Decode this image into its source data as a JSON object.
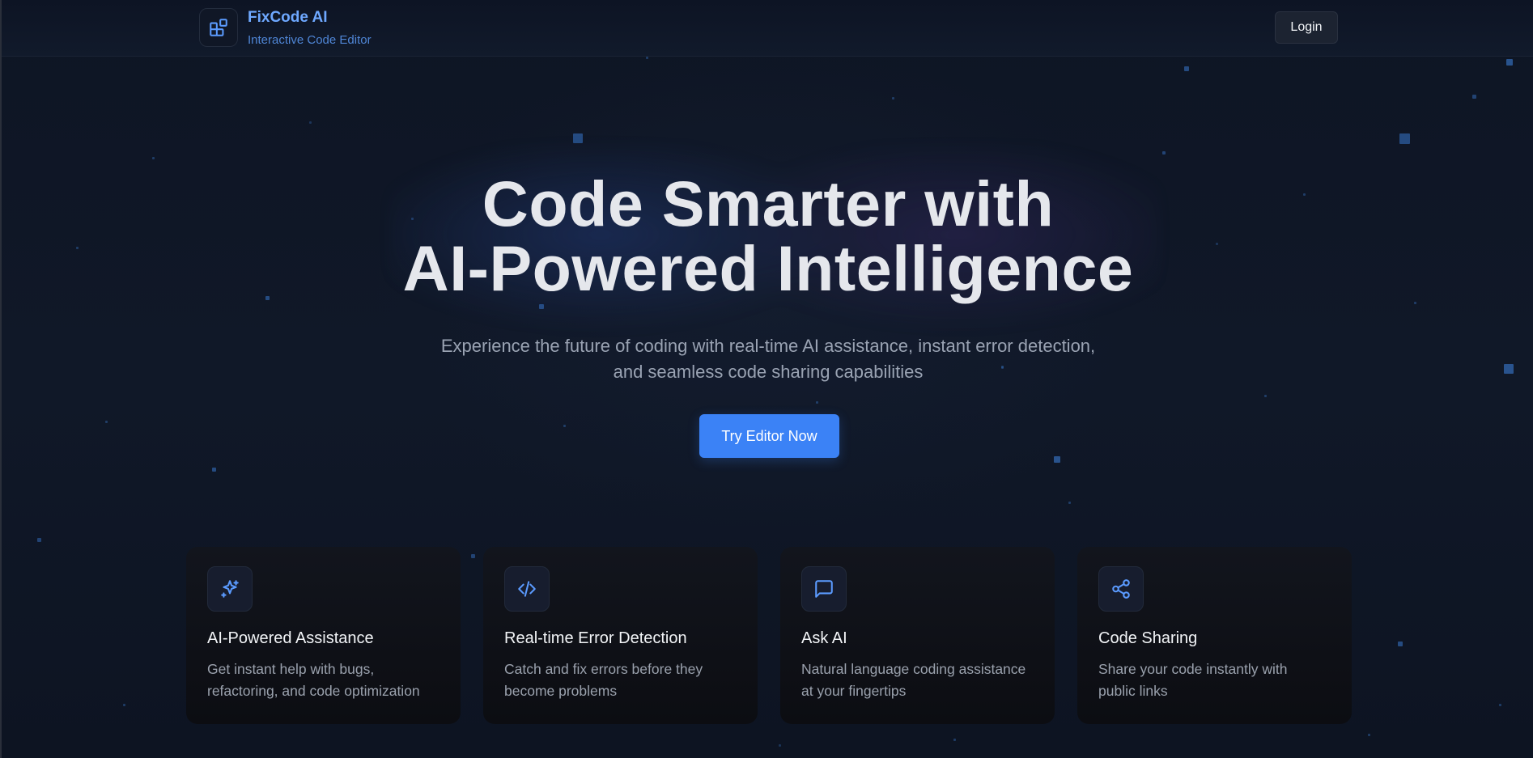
{
  "header": {
    "brand_name": "FixCode AI",
    "brand_subtitle": "Interactive Code Editor",
    "logo_icon": "blocks-icon",
    "login_label": "Login"
  },
  "hero": {
    "title_line1": "Code Smarter with",
    "title_line2": "AI-Powered Intelligence",
    "subtitle_line1": "Experience the future of coding with real-time AI assistance, instant error detection,",
    "subtitle_line2": "and seamless code sharing capabilities",
    "cta_label": "Try Editor Now"
  },
  "features": [
    {
      "icon": "sparkles-icon",
      "title": "AI-Powered Assistance",
      "desc_line1": "Get instant help with bugs,",
      "desc_line2": "refactoring, and code optimization"
    },
    {
      "icon": "code-icon",
      "title": "Real-time Error Detection",
      "desc_line1": "Catch and fix errors before they",
      "desc_line2": "become problems"
    },
    {
      "icon": "message-square-icon",
      "title": "Ask AI",
      "desc_line1": "Natural language coding assistance",
      "desc_line2": "at your fingertips"
    },
    {
      "icon": "share-icon",
      "title": "Code Sharing",
      "desc_line1": "Share your code instantly with",
      "desc_line2": "public links"
    }
  ],
  "colors": {
    "background": "#0f1626",
    "accent": "#3b82f6",
    "brand_text": "#6ea8ff",
    "icon_blue": "#5b9bff",
    "card_bg": "#0f1118"
  }
}
